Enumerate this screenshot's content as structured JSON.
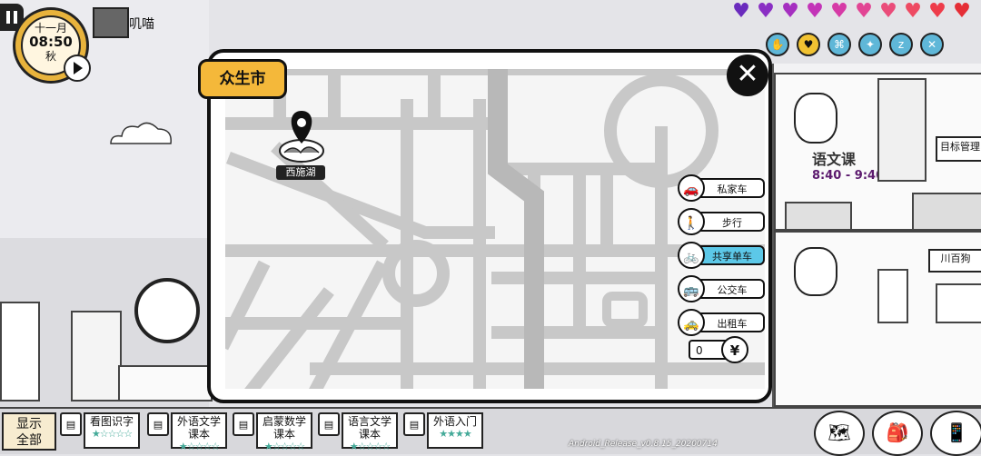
{
  "clock": {
    "month": "十一月",
    "time": "08:50",
    "season": "秋"
  },
  "player": {
    "name": "叽喵"
  },
  "hearts": {
    "colors": [
      "#6a2bbd",
      "#8a2fc4",
      "#a52fc0",
      "#c334b8",
      "#d63aa6",
      "#e24594",
      "#ea4c7a",
      "#ee4a62",
      "#ee3c4a",
      "#e52e36"
    ]
  },
  "status_icons": [
    "handshake-icon",
    "heart-icon",
    "gamepad-icon",
    "sparkle-icon",
    "sleep-icon",
    "utensils-icon"
  ],
  "map": {
    "city": "众生市",
    "close_label": "✕",
    "place": "西施湖",
    "transport": [
      {
        "label": "私家车",
        "icon": "car-icon",
        "glyph": "🚗",
        "selected": false
      },
      {
        "label": "步行",
        "icon": "walk-icon",
        "glyph": "🚶",
        "selected": false
      },
      {
        "label": "共享单车",
        "icon": "bike-icon",
        "glyph": "🚲",
        "selected": true
      },
      {
        "label": "公交车",
        "icon": "bus-icon",
        "glyph": "🚌",
        "selected": false
      },
      {
        "label": "出租车",
        "icon": "taxi-icon",
        "glyph": "🚕",
        "selected": false
      }
    ],
    "money": "0",
    "currency": "¥"
  },
  "scene": {
    "class_name": "语文课",
    "class_time": "8:40 - 9:40",
    "goal_button": "目标管理",
    "shop_sign": "川百狗"
  },
  "bottom": {
    "show_all": "显示\n全部",
    "books": [
      {
        "title": "看图识字",
        "stars": "★☆☆☆☆"
      },
      {
        "title": "外语文学\n课本",
        "stars": "★☆☆☆☆"
      },
      {
        "title": "启蒙数学\n课本",
        "stars": "★☆☆☆☆"
      },
      {
        "title": "语言文学\n课本",
        "stars": "★☆☆☆☆"
      },
      {
        "title": "外语入门",
        "stars": "★★★★"
      }
    ],
    "version": "Android_Release_v0.8.15_20200714"
  }
}
